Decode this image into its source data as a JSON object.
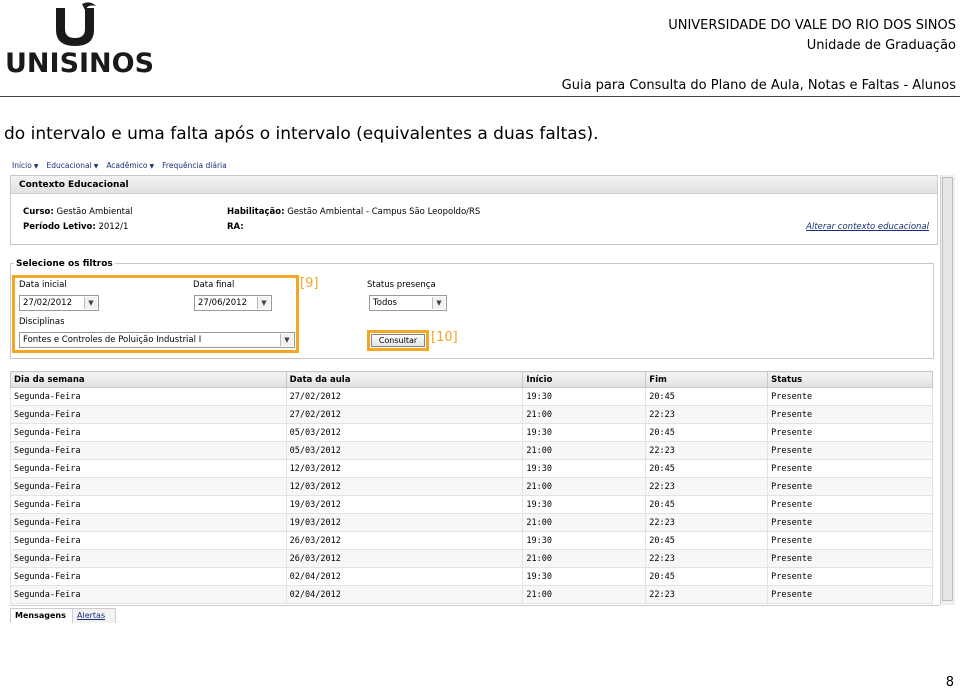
{
  "header": {
    "logo_text": "UNISINOS",
    "university": "UNIVERSIDADE DO VALE DO RIO DOS SINOS",
    "unit": "Unidade de Graduação",
    "guide_title": "Guia para Consulta do Plano de Aula, Notas e Faltas - Alunos"
  },
  "intro_text": "do intervalo e uma falta após o intervalo (equivalentes a duas faltas).",
  "nav": [
    "Início",
    "Educacional",
    "Acadêmico",
    "Frequência diária"
  ],
  "context": {
    "title": "Contexto Educacional",
    "curso_label": "Curso:",
    "curso_value": "Gestão Ambiental",
    "periodo_label": "Período Letivo:",
    "periodo_value": "2012/1",
    "habilitacao_label": "Habilitação:",
    "habilitacao_value": "Gestão Ambiental - Campus São Leopoldo/RS",
    "ra_label": "RA:",
    "change_link": "Alterar contexto educacional"
  },
  "filters": {
    "title": "Selecione os filtros",
    "data_inicial_label": "Data inicial",
    "data_inicial_value": "27/02/2012",
    "data_final_label": "Data final",
    "data_final_value": "27/06/2012",
    "status_label": "Status presença",
    "status_value": "Todos",
    "disciplinas_label": "Disciplinas",
    "disciplinas_value": "Fontes e Controles de Poluição Industrial I",
    "consultar_label": "Consultar",
    "annotation_9": "[9]",
    "annotation_10": "[10]"
  },
  "table": {
    "headers": [
      "Dia da semana",
      "Data da aula",
      "Início",
      "Fim",
      "Status"
    ],
    "rows": [
      [
        "Segunda-Feira",
        "27/02/2012",
        "19:30",
        "20:45",
        "Presente"
      ],
      [
        "Segunda-Feira",
        "27/02/2012",
        "21:00",
        "22:23",
        "Presente"
      ],
      [
        "Segunda-Feira",
        "05/03/2012",
        "19:30",
        "20:45",
        "Presente"
      ],
      [
        "Segunda-Feira",
        "05/03/2012",
        "21:00",
        "22:23",
        "Presente"
      ],
      [
        "Segunda-Feira",
        "12/03/2012",
        "19:30",
        "20:45",
        "Presente"
      ],
      [
        "Segunda-Feira",
        "12/03/2012",
        "21:00",
        "22:23",
        "Presente"
      ],
      [
        "Segunda-Feira",
        "19/03/2012",
        "19:30",
        "20:45",
        "Presente"
      ],
      [
        "Segunda-Feira",
        "19/03/2012",
        "21:00",
        "22:23",
        "Presente"
      ],
      [
        "Segunda-Feira",
        "26/03/2012",
        "19:30",
        "20:45",
        "Presente"
      ],
      [
        "Segunda-Feira",
        "26/03/2012",
        "21:00",
        "22:23",
        "Presente"
      ],
      [
        "Segunda-Feira",
        "02/04/2012",
        "19:30",
        "20:45",
        "Presente"
      ],
      [
        "Segunda-Feira",
        "02/04/2012",
        "21:00",
        "22:23",
        "Presente"
      ]
    ]
  },
  "tabs": [
    "Mensagens",
    "Alertas"
  ],
  "page_number": "8",
  "colors": {
    "highlight": "#f5a623",
    "link": "#1a2f7a"
  }
}
